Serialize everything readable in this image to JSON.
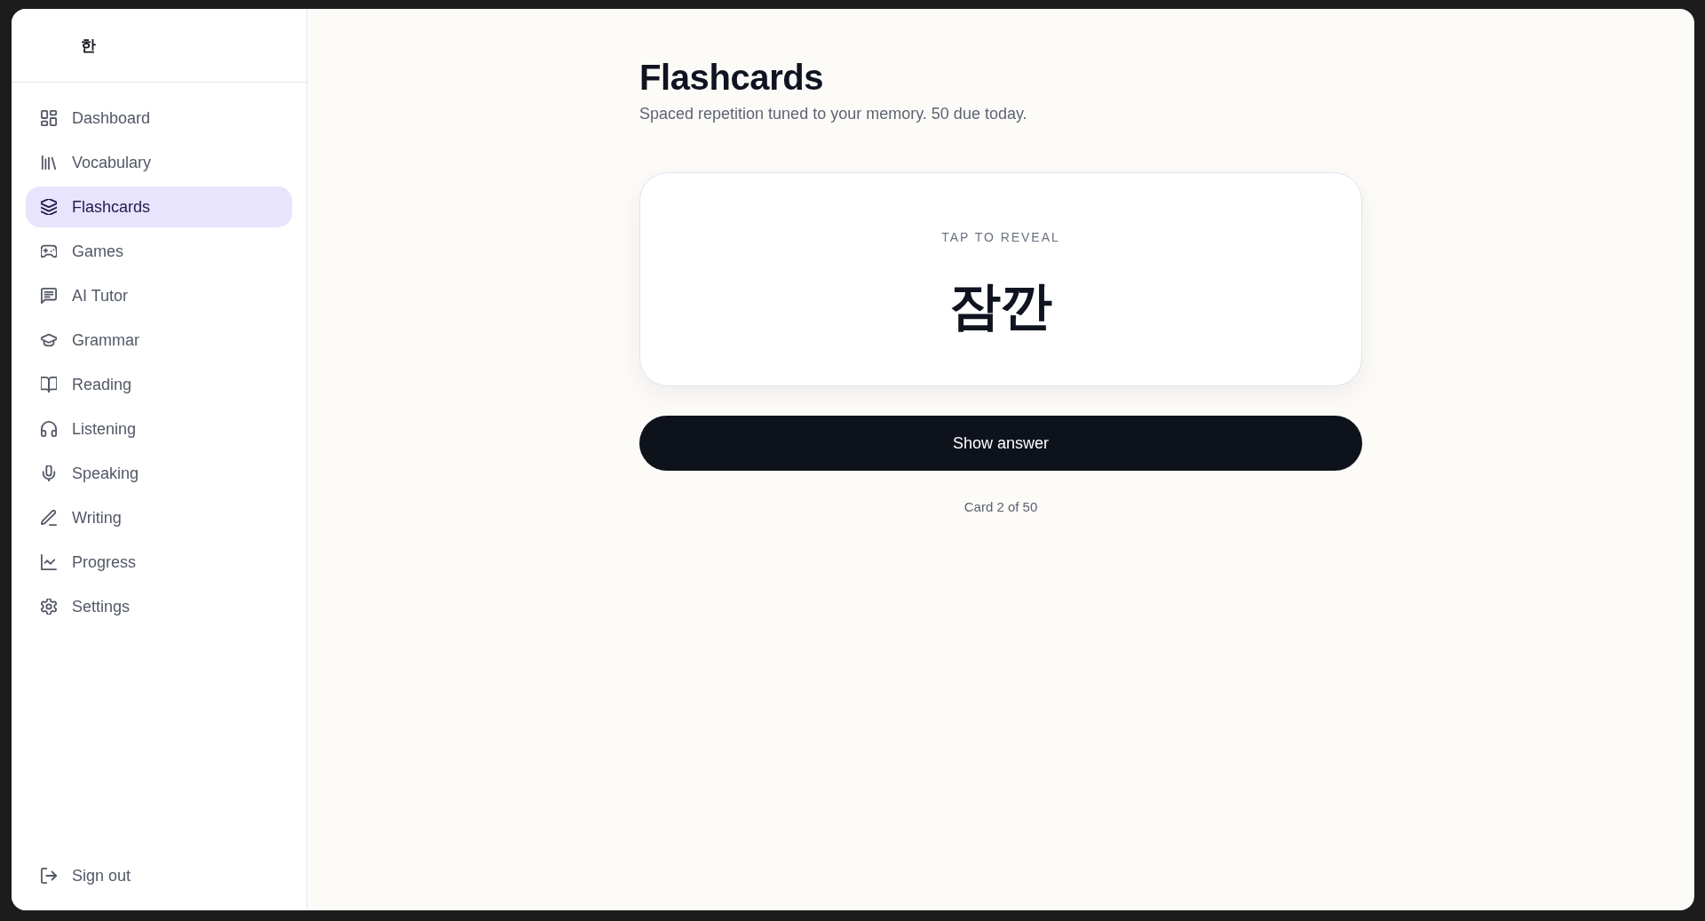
{
  "logo": {
    "text": "한"
  },
  "nav": [
    {
      "label": "Dashboard",
      "selected": false
    },
    {
      "label": "Vocabulary",
      "selected": false
    },
    {
      "label": "Flashcards",
      "selected": true
    },
    {
      "label": "Games",
      "selected": false
    },
    {
      "label": "AI Tutor",
      "selected": false
    },
    {
      "label": "Grammar",
      "selected": false
    },
    {
      "label": "Reading",
      "selected": false
    },
    {
      "label": "Listening",
      "selected": false
    },
    {
      "label": "Speaking",
      "selected": false
    },
    {
      "label": "Writing",
      "selected": false
    },
    {
      "label": "Progress",
      "selected": false
    },
    {
      "label": "Settings",
      "selected": false
    }
  ],
  "sign_out": {
    "label": "Sign out"
  },
  "header": {
    "title": "Flashcards",
    "subtitle": "Spaced repetition tuned to your memory. 50 due today."
  },
  "card": {
    "hint": "TAP TO REVEAL",
    "word": "잠깐"
  },
  "action": {
    "label": "Show answer"
  },
  "progress": {
    "text": "Card 2 of 50"
  }
}
